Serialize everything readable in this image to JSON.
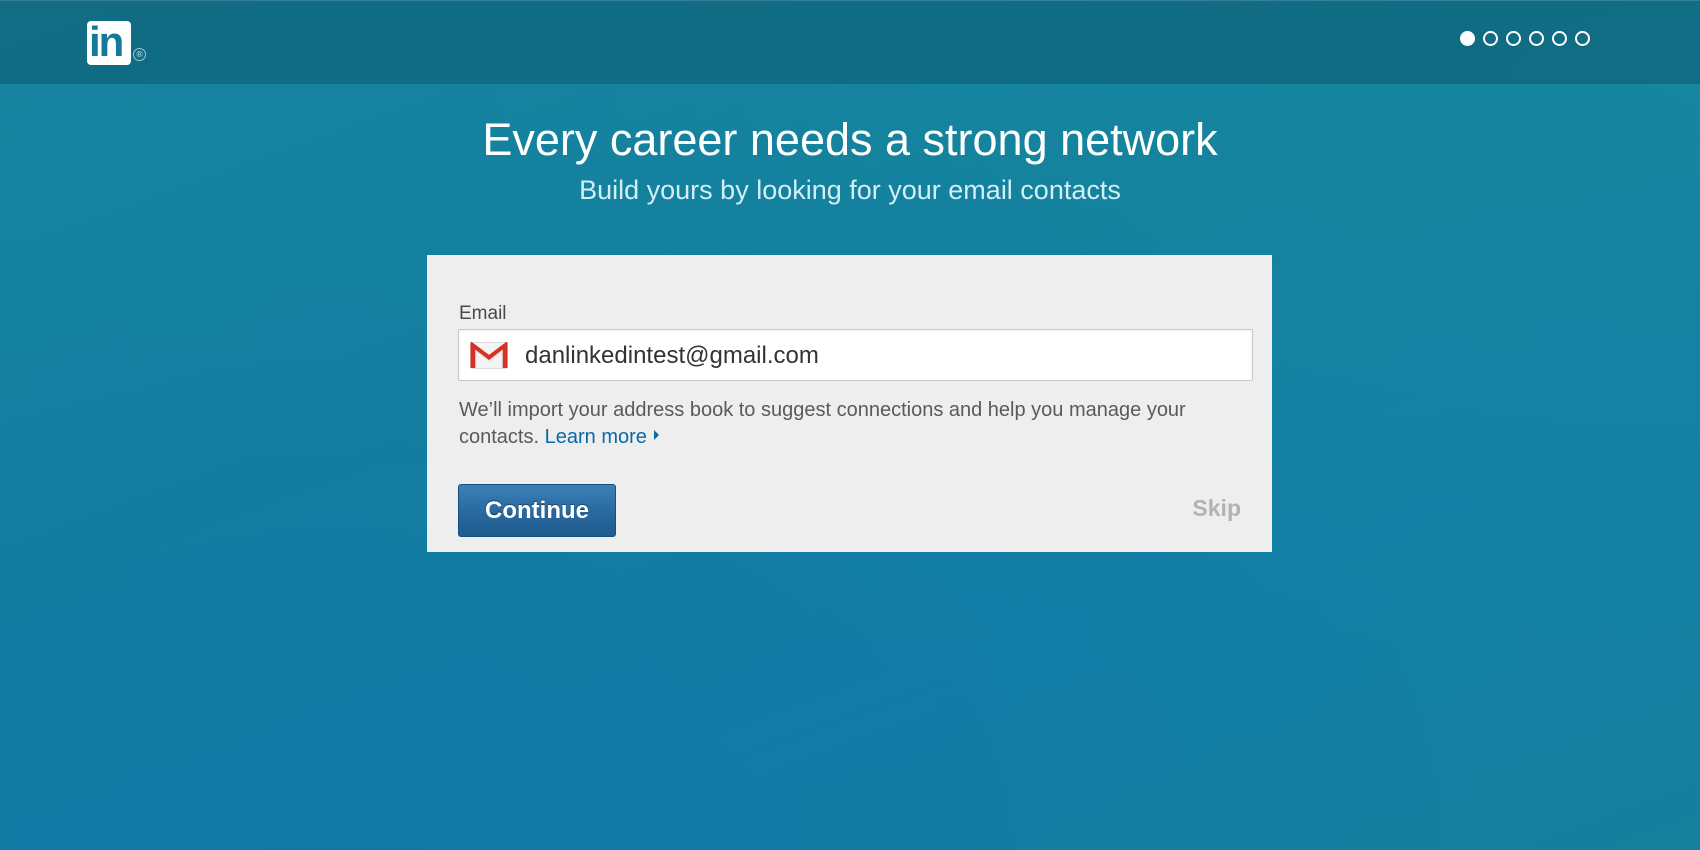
{
  "header": {
    "logo_text": "in",
    "logo_registered": "®",
    "steps": {
      "total": 6,
      "current": 1
    }
  },
  "hero": {
    "title": "Every career needs a strong network",
    "subtitle": "Build yours by looking for your email contacts"
  },
  "form": {
    "email_label": "Email",
    "email_value": "danlinkedintest@gmail.com",
    "provider_icon": "gmail-icon",
    "help_text": "We’ll import your address book to suggest connections and help you manage your contacts.",
    "learn_more_label": "Learn more",
    "continue_label": "Continue",
    "skip_label": "Skip"
  },
  "colors": {
    "brand": "#0077b5",
    "button": "#2a6aa1",
    "link": "#0a6aa6",
    "gmail_red": "#d93025"
  }
}
